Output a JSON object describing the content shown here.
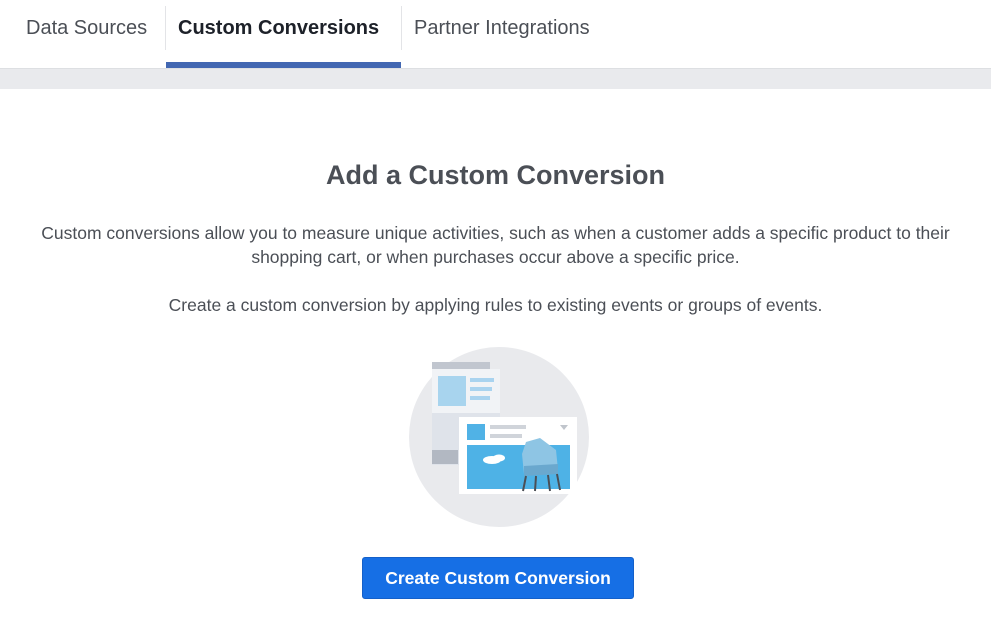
{
  "tabs": [
    {
      "label": "Data Sources",
      "active": false
    },
    {
      "label": "Custom Conversions",
      "active": true
    },
    {
      "label": "Partner Integrations",
      "active": false
    }
  ],
  "main": {
    "title": "Add a Custom Conversion",
    "description": "Custom conversions allow you to measure unique activities, such as when a customer adds a specific product to their shopping cart, or when purchases occur above a specific price.",
    "instruction": "Create a custom conversion by applying rules to existing events or groups of events.",
    "illustration_icon": "custom-conversion-illustration",
    "create_button_label": "Create Custom Conversion"
  },
  "colors": {
    "accent": "#4267b2",
    "button": "#166fe5",
    "band": "#e9eaed"
  }
}
